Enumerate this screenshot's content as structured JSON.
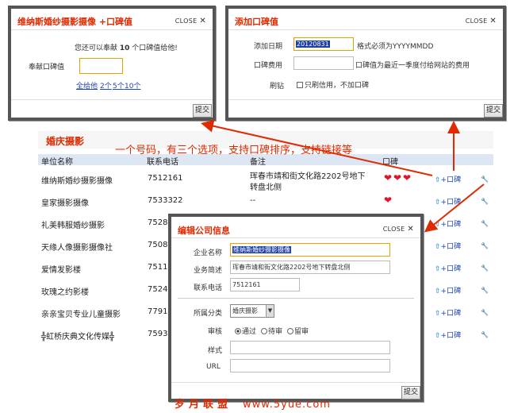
{
  "close_label": "CLOSE",
  "close_icon": "✕",
  "dialog1": {
    "title": "维纳斯婚纱摄影摄像 +口碑值",
    "message_pre": "您还可以奉献",
    "message_count": "10",
    "message_post": "个口碑值给他!",
    "field_label": "奉献口碑值",
    "field_value": "",
    "link_all": "全给他",
    "link_2": "2个",
    "link_5": "5个",
    "link_10": "10个",
    "submit": "提交"
  },
  "dialog2": {
    "title": "添加口碑值",
    "date_label": "添加日期",
    "date_value": "20120831",
    "date_hint": "格式必须为YYYYMMDD",
    "fee_label": "口碑费用",
    "fee_value": "",
    "fee_hint": "口碑值为最近一季度付给网站的费用",
    "brush_label": "刷钻",
    "brush_option": "只刷信用，不加口碑",
    "submit": "提交"
  },
  "section": {
    "title": "婚庆摄影",
    "annotation": "一个号码，有三个选项，支持口碑排序，支持链接等",
    "columns": [
      "单位名称",
      "联系电话",
      "备注",
      "口碑"
    ],
    "rows": [
      {
        "name": "维纳斯婚纱摄影摄像",
        "phone": "7512161",
        "note": "珲春市靖和街文化路2202号地下",
        "note2": "转盘北侧",
        "hearts": 3
      },
      {
        "name": "皇家摄影摄像",
        "phone": "7533322",
        "note": "--",
        "note2": "",
        "hearts": 1
      },
      {
        "name": "礼美韩服婚纱摄影",
        "phone": "7528",
        "note": "",
        "note2": "",
        "hearts": 0
      },
      {
        "name": "天缘人像摄影摄像社",
        "phone": "7508",
        "note": "",
        "note2": "",
        "hearts": 0
      },
      {
        "name": "爱情发影楼",
        "phone": "7511",
        "note": "",
        "note2": "",
        "hearts": 0
      },
      {
        "name": "玫瑰之约影楼",
        "phone": "7524",
        "note": "",
        "note2": "",
        "hearts": 0
      },
      {
        "name": "亲亲宝贝专业儿童摄影",
        "phone": "7791",
        "note": "",
        "note2": "",
        "hearts": 0
      },
      {
        "name": "╬虹桥庆典文化传媒╬",
        "phone": "7593",
        "note": "",
        "note2": "",
        "hearts": 0
      }
    ],
    "action_label": "+口碑",
    "heart_glyph": "❤",
    "up_icon": "up-arrow-icon",
    "wrench_icon": "wrench-icon"
  },
  "dialog3": {
    "title": "编辑公司信息",
    "company_label": "企业名称",
    "company_value": "维纳斯婚纱摄影摄像",
    "business_label": "业务简述",
    "business_value": "珲春市靖和街文化路2202号地下转盘北侧",
    "phone_label": "联系电话",
    "phone_value": "7512161",
    "category_label": "所属分类",
    "category_value": "婚庆摄影",
    "review_label": "审核",
    "review_options": [
      "通过",
      "待审",
      "留审"
    ],
    "style_label": "样式",
    "style_value": "",
    "url_label": "URL",
    "url_value": "",
    "submit": "提交"
  },
  "footer": {
    "brand": "岁月联盟",
    "site": "www.5yue.com"
  },
  "colors": {
    "accent": "#e02a00",
    "link": "#2246b3",
    "header_bg": "#dde6f3"
  }
}
